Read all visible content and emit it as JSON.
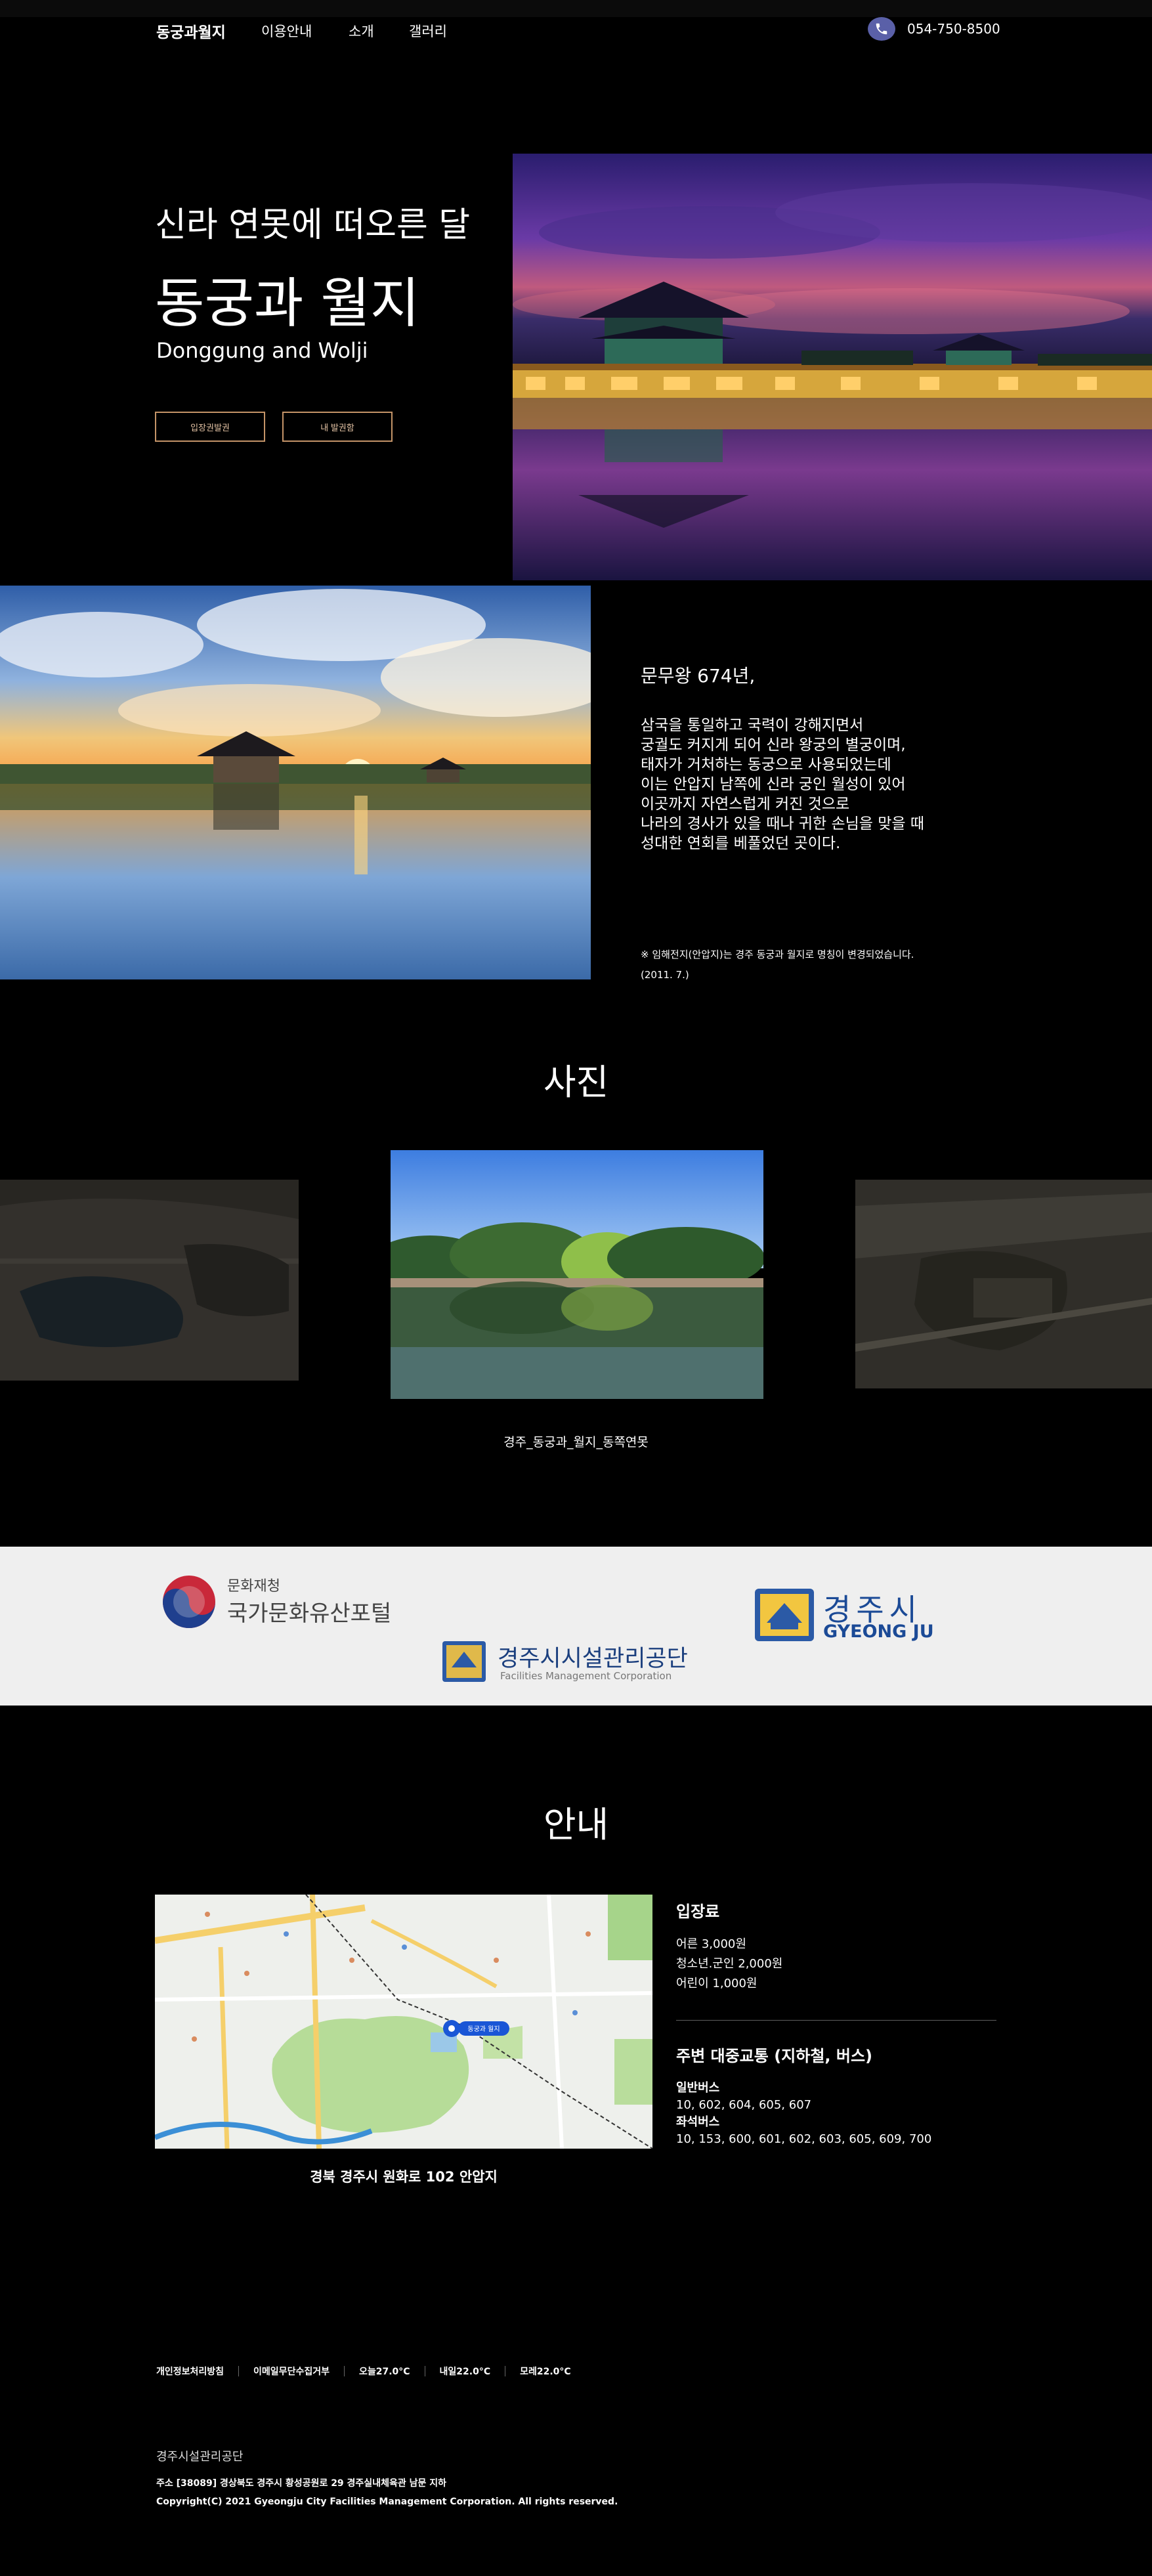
{
  "header": {
    "logo": "동궁과월지",
    "nav": [
      "이용안내",
      "소개",
      "갤러리"
    ],
    "phone": "054-750-8500",
    "phone_icon": "phone-icon"
  },
  "hero": {
    "subtitle": "신라 연못에 떠오른 달",
    "title": "동궁과 월지",
    "title_en": "Donggung and Wolji",
    "buttons": [
      "입장권발권",
      "내 발권함"
    ]
  },
  "about": {
    "heading": "문무왕 674년,",
    "lines": [
      "삼국을 통일하고 국력이 강해지면서",
      "궁궐도 커지게 되어 신라 왕궁의 별궁이며,",
      "태자가 거처하는 동궁으로 사용되었는데",
      "이는 안압지 남쪽에 신라 궁인 월성이 있어",
      "이곳까지 자연스럽게 커진 것으로",
      "나라의 경사가 있을 때나 귀한 손님을 맞을 때",
      "성대한 연회를 베풀었던 곳이다."
    ],
    "note_line1": "※ 임해전지(안압지)는 경주 동궁과 월지로 명칭이 변경되었습니다.",
    "note_line2": "(2011. 7.)"
  },
  "gallery": {
    "title": "사진",
    "caption": "경주_동궁과_월지_동쪽연못"
  },
  "partners": {
    "heritage_small": "문화재청",
    "heritage_main": "국가문화유산포털",
    "gyeongju_kr": "경주시",
    "gyeongju_en": "GYEONG JU",
    "fmc_kr": "경주시시설관리공단",
    "fmc_en": "Facilities Management Corporation"
  },
  "info": {
    "title": "안내",
    "map_address": "경북 경주시 원화로 102 안압지",
    "map_marker_label": "동궁과 월지",
    "fee_heading": "입장료",
    "fees": [
      "어른 3,000원",
      "청소년.군인 2,000원",
      "어린이 1,000원"
    ],
    "transit_heading": "주변 대중교통 (지하철, 버스)",
    "bus_general_label": "일반버스",
    "bus_general": "10, 602, 604, 605, 607",
    "bus_seat_label": "좌석버스",
    "bus_seat": "10, 153, 600, 601, 602, 603, 605, 609, 700"
  },
  "footer": {
    "links": [
      "개인정보처리방침",
      "이메일무단수집거부",
      "오늘27.0°C",
      "내일22.0°C",
      "모레22.0°C"
    ],
    "org": "경주시설관리공단",
    "address": "주소 [38089] 경상북도 경주시 황성공원로 29 경주실내체육관 남문 지하",
    "copyright": "Copyright(C) 2021 Gyeongju City Facilities Management Corporation. All rights reserved."
  }
}
